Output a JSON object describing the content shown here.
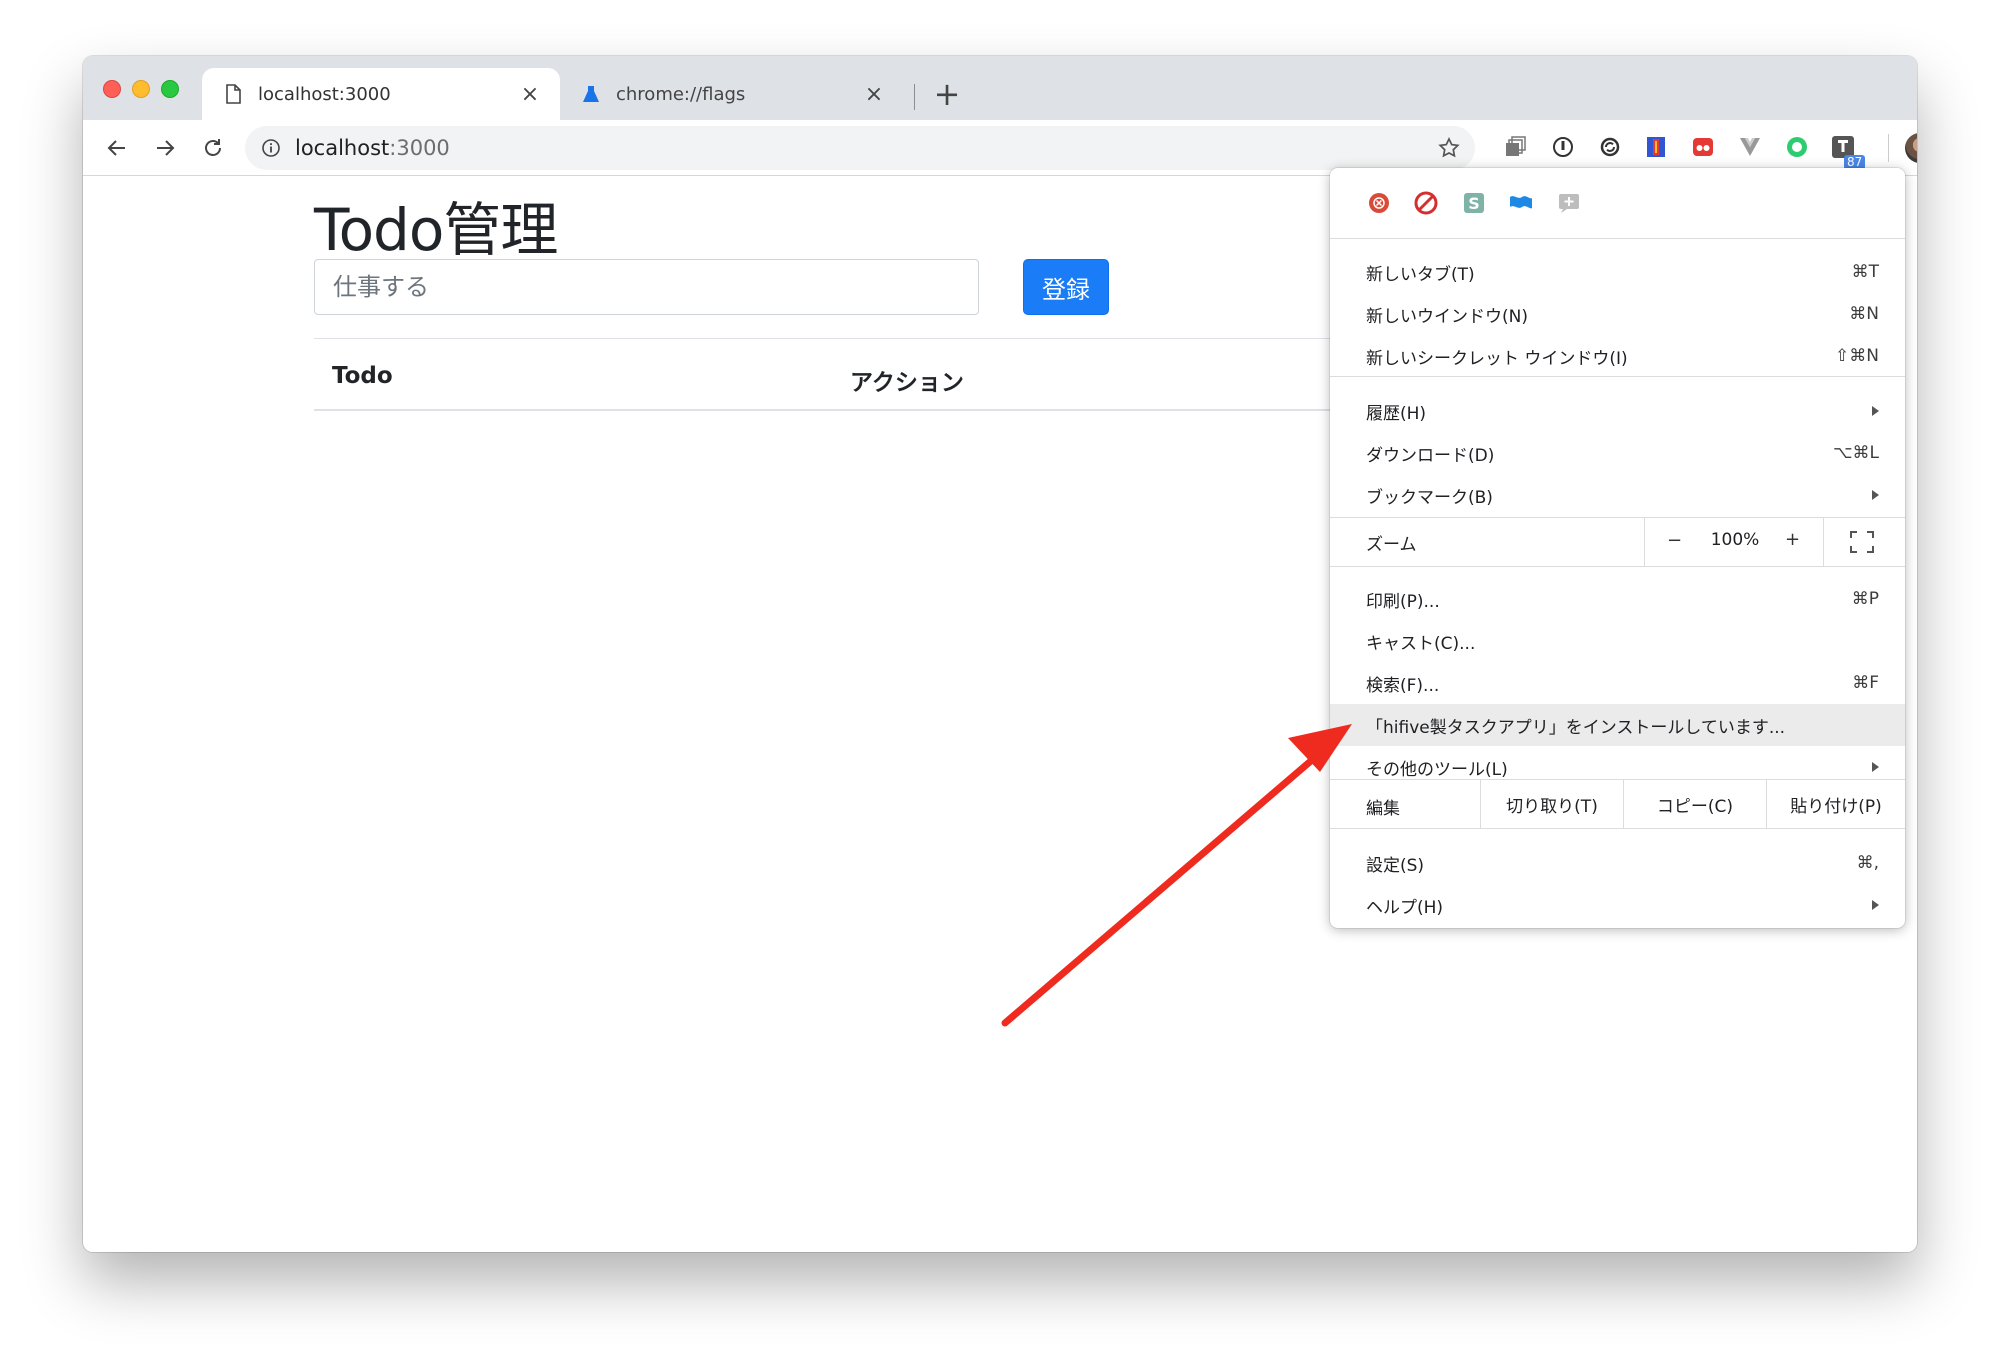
{
  "tabs": [
    {
      "title": "localhost:3000",
      "icon": "page-icon",
      "active": true
    },
    {
      "title": "chrome://flags",
      "icon": "flask-icon",
      "active": false
    }
  ],
  "address_bar": {
    "host": "localhost",
    "port": ":3000"
  },
  "extensions_badge": "87",
  "page": {
    "heading": "Todo管理",
    "input_placeholder": "仕事する",
    "submit_label": "登録",
    "table_headers": [
      "Todo",
      "アクション"
    ]
  },
  "menu": {
    "groups": [
      [
        {
          "label": "新しいタブ(T)",
          "shortcut": "⌘T"
        },
        {
          "label": "新しいウインドウ(N)",
          "shortcut": "⌘N"
        },
        {
          "label": "新しいシークレット ウインドウ(I)",
          "shortcut": "⇧⌘N"
        }
      ],
      [
        {
          "label": "履歴(H)",
          "submenu": true
        },
        {
          "label": "ダウンロード(D)",
          "shortcut": "⌥⌘L"
        },
        {
          "label": "ブックマーク(B)",
          "submenu": true
        }
      ]
    ],
    "zoom": {
      "label": "ズーム",
      "minus": "−",
      "value": "100%",
      "plus": "+"
    },
    "tools": [
      {
        "label": "印刷(P)...",
        "shortcut": "⌘P"
      },
      {
        "label": "キャスト(C)..."
      },
      {
        "label": "検索(F)...",
        "shortcut": "⌘F"
      },
      {
        "label": "「hifive製タスクアプリ」をインストールしています...",
        "highlighted": true
      },
      {
        "label": "その他のツール(L)",
        "submenu": true
      }
    ],
    "edit": {
      "label": "編集",
      "cut": "切り取り(T)",
      "copy": "コピー(C)",
      "paste": "貼り付け(P)"
    },
    "bottom": [
      {
        "label": "設定(S)",
        "shortcut": "⌘,"
      },
      {
        "label": "ヘルプ(H)",
        "submenu": true
      }
    ]
  },
  "colors": {
    "accent": "#1a7cf7",
    "arrow": "#ef2a1f"
  }
}
